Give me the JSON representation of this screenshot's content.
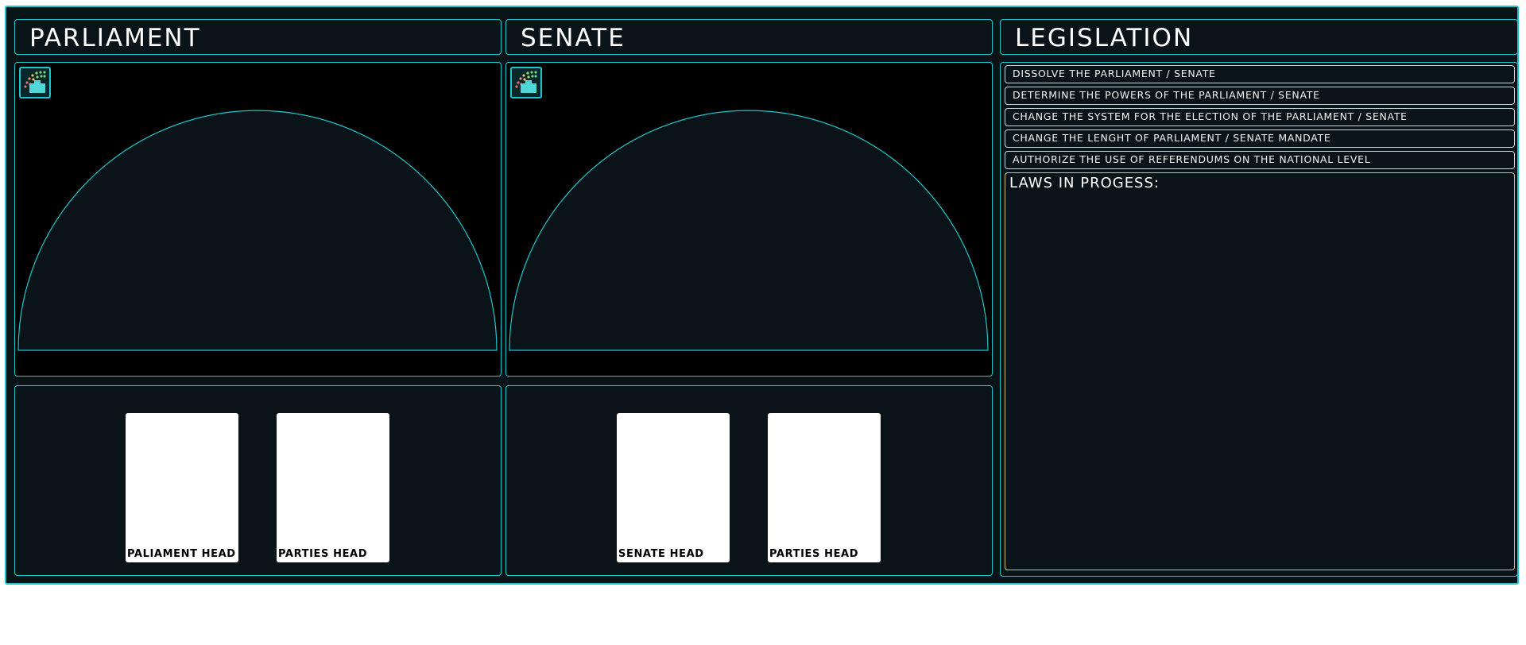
{
  "parliament": {
    "title": "PARLIAMENT",
    "heads": [
      "PALIAMENT HEAD",
      "PARTIES HEAD"
    ]
  },
  "senate": {
    "title": "SENATE",
    "heads": [
      "SENATE HEAD",
      "PARTIES HEAD"
    ]
  },
  "legislation": {
    "title": "LEGISLATION",
    "actions": [
      "DISSOLVE THE PARLIAMENT / SENATE",
      "DETERMINE THE POWERS OF THE PARLIAMENT / SENATE",
      "CHANGE THE SYSTEM FOR THE ELECTION OF THE PARLIAMENT / SENATE",
      "CHANGE THE LENGHT OF PARLIAMENT / SENATE MANDATE",
      "AUTHORIZE THE USE OF REFERENDUMS ON THE NATIONAL LEVEL"
    ],
    "laws_in_progress_label": "LAWS IN PROGESS:"
  },
  "icons": {
    "chamber": "parliament-seats-icon"
  },
  "colors": {
    "accent": "#1cc6cc",
    "panel_bg": "#0a1418",
    "chamber_bg": "#000000",
    "laws_border": "#d6c170"
  }
}
